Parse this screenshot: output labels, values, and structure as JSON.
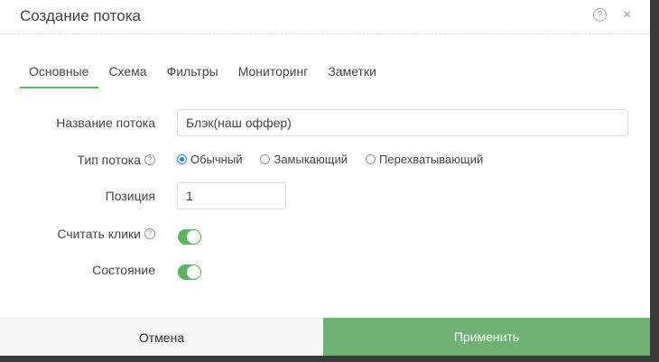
{
  "header": {
    "title": "Создание потока",
    "help_icon": "?",
    "close_icon": "×"
  },
  "tabs": [
    {
      "label": "Основные",
      "active": true
    },
    {
      "label": "Схема",
      "active": false
    },
    {
      "label": "Фильтры",
      "active": false
    },
    {
      "label": "Мониторинг",
      "active": false
    },
    {
      "label": "Заметки",
      "active": false
    }
  ],
  "form": {
    "name_label": "Название потока",
    "name_value": "Блэк(наш оффер)",
    "type_label": "Тип потока",
    "type_options": [
      {
        "label": "Обычный",
        "checked": true
      },
      {
        "label": "Замыкающий",
        "checked": false
      },
      {
        "label": "Перехватывающий",
        "checked": false
      }
    ],
    "position_label": "Позиция",
    "position_value": "1",
    "count_clicks_label": "Считать клики",
    "count_clicks_on": true,
    "state_label": "Состояние",
    "state_on": true
  },
  "footer": {
    "cancel_label": "Отмена",
    "apply_label": "Применить"
  },
  "colors": {
    "accent_green": "#6fb173",
    "toggle_green": "#5cb462",
    "radio_blue": "#1e88e5"
  }
}
